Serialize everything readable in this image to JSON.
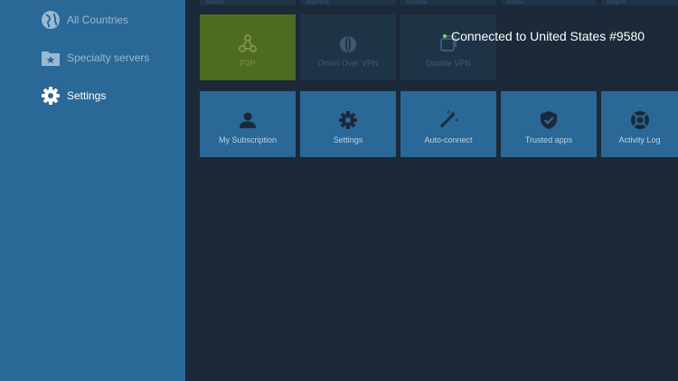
{
  "sidebar": {
    "items": [
      {
        "label": "All Countries",
        "icon": "globe-icon"
      },
      {
        "label": "Specialty servers",
        "icon": "folder-star-icon"
      },
      {
        "label": "Settings",
        "icon": "gear-icon",
        "active": true
      }
    ]
  },
  "country_row": [
    "Albania",
    "Argentina",
    "Australia",
    "Austria",
    "Belgium"
  ],
  "specialty_tiles": [
    {
      "label": "P2P",
      "icon": "p2p-icon"
    },
    {
      "label": "Onion Over VPN",
      "icon": "onion-icon"
    },
    {
      "label": "Double VPN",
      "icon": "double-vpn-icon"
    }
  ],
  "settings_tiles": [
    {
      "label": "My Subscription",
      "icon": "user-icon"
    },
    {
      "label": "Settings",
      "icon": "gear-icon"
    },
    {
      "label": "Auto-connect",
      "icon": "magic-wand-icon"
    },
    {
      "label": "Trusted apps",
      "icon": "shield-check-icon"
    },
    {
      "label": "Activity Log",
      "icon": "lifebuoy-icon"
    }
  ],
  "status": {
    "text": "Connected to United States #9580"
  },
  "colors": {
    "sidebar": "#2a6897",
    "background": "#1b2938",
    "tile_blue": "#2a6897",
    "tile_green": "#4e6c21",
    "tile_dim": "#1f3346",
    "status_dot": "#7ed957"
  }
}
